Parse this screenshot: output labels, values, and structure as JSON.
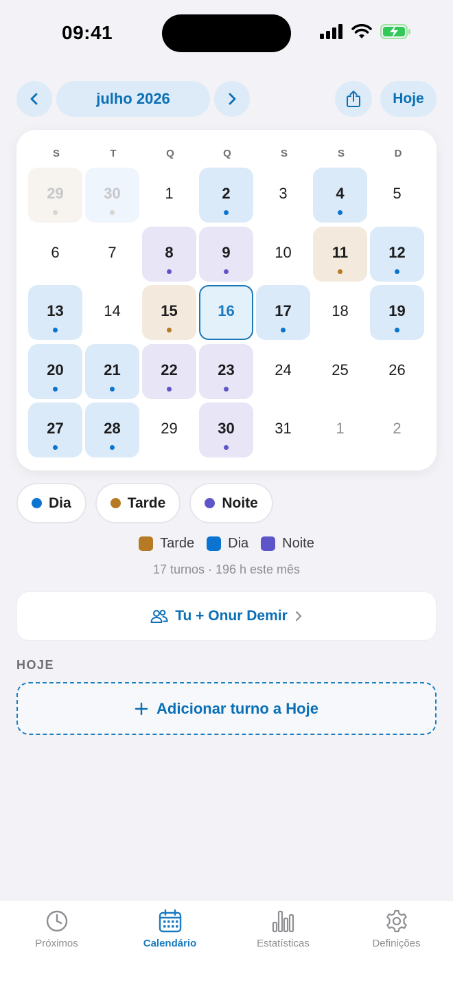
{
  "status_bar": {
    "time": "09:41"
  },
  "header": {
    "month_title": "julho 2026",
    "today_label": "Hoje",
    "prev_icon": "chevron-left-icon",
    "next_icon": "chevron-right-icon",
    "share_icon": "share-icon"
  },
  "calendar": {
    "weekdays": [
      "S",
      "T",
      "Q",
      "Q",
      "S",
      "S",
      "D"
    ],
    "weeks": [
      [
        {
          "day": "29",
          "shift": "tarde",
          "outside": true
        },
        {
          "day": "30",
          "shift": "dia",
          "outside": true
        },
        {
          "day": "1",
          "shift": null
        },
        {
          "day": "2",
          "shift": "dia"
        },
        {
          "day": "3",
          "shift": null
        },
        {
          "day": "4",
          "shift": "dia"
        },
        {
          "day": "5",
          "shift": null
        }
      ],
      [
        {
          "day": "6",
          "shift": null
        },
        {
          "day": "7",
          "shift": null
        },
        {
          "day": "8",
          "shift": "noite"
        },
        {
          "day": "9",
          "shift": "noite"
        },
        {
          "day": "10",
          "shift": null
        },
        {
          "day": "11",
          "shift": "tarde"
        },
        {
          "day": "12",
          "shift": "dia"
        }
      ],
      [
        {
          "day": "13",
          "shift": "dia"
        },
        {
          "day": "14",
          "shift": null
        },
        {
          "day": "15",
          "shift": "tarde"
        },
        {
          "day": "16",
          "shift": null,
          "today": true
        },
        {
          "day": "17",
          "shift": "dia"
        },
        {
          "day": "18",
          "shift": null
        },
        {
          "day": "19",
          "shift": "dia"
        }
      ],
      [
        {
          "day": "20",
          "shift": "dia"
        },
        {
          "day": "21",
          "shift": "dia"
        },
        {
          "day": "22",
          "shift": "noite"
        },
        {
          "day": "23",
          "shift": "noite"
        },
        {
          "day": "24",
          "shift": null
        },
        {
          "day": "25",
          "shift": null
        },
        {
          "day": "26",
          "shift": null
        }
      ],
      [
        {
          "day": "27",
          "shift": "dia"
        },
        {
          "day": "28",
          "shift": "dia"
        },
        {
          "day": "29",
          "shift": null
        },
        {
          "day": "30",
          "shift": "noite"
        },
        {
          "day": "31",
          "shift": null
        },
        {
          "day": "1",
          "shift": null,
          "outside": true
        },
        {
          "day": "2",
          "shift": null,
          "outside": true
        }
      ]
    ]
  },
  "filters": [
    {
      "label": "Dia",
      "color": "#0b74d0"
    },
    {
      "label": "Tarde",
      "color": "#b77a24"
    },
    {
      "label": "Noite",
      "color": "#5e55c8"
    }
  ],
  "legend": [
    {
      "label": "Tarde",
      "color": "#b77a24"
    },
    {
      "label": "Dia",
      "color": "#0b74d0"
    },
    {
      "label": "Noite",
      "color": "#5e55c8"
    }
  ],
  "summary": "17 turnos · 196 h este mês",
  "partner": {
    "label": "Tu + Onur Demir",
    "icon": "people-icon"
  },
  "today_section": {
    "title": "HOJE",
    "add_label": "Adicionar turno a Hoje"
  },
  "tabs": [
    {
      "label": "Próximos",
      "icon": "clock-icon",
      "active": false
    },
    {
      "label": "Calendário",
      "icon": "calendar-icon",
      "active": true
    },
    {
      "label": "Estatísticas",
      "icon": "bar-chart-icon",
      "active": false
    },
    {
      "label": "Definições",
      "icon": "gear-icon",
      "active": false
    }
  ],
  "colors": {
    "accent": "#0a6fb5",
    "dia": "#0b74d0",
    "tarde": "#b77a24",
    "noite": "#5e55c8"
  }
}
